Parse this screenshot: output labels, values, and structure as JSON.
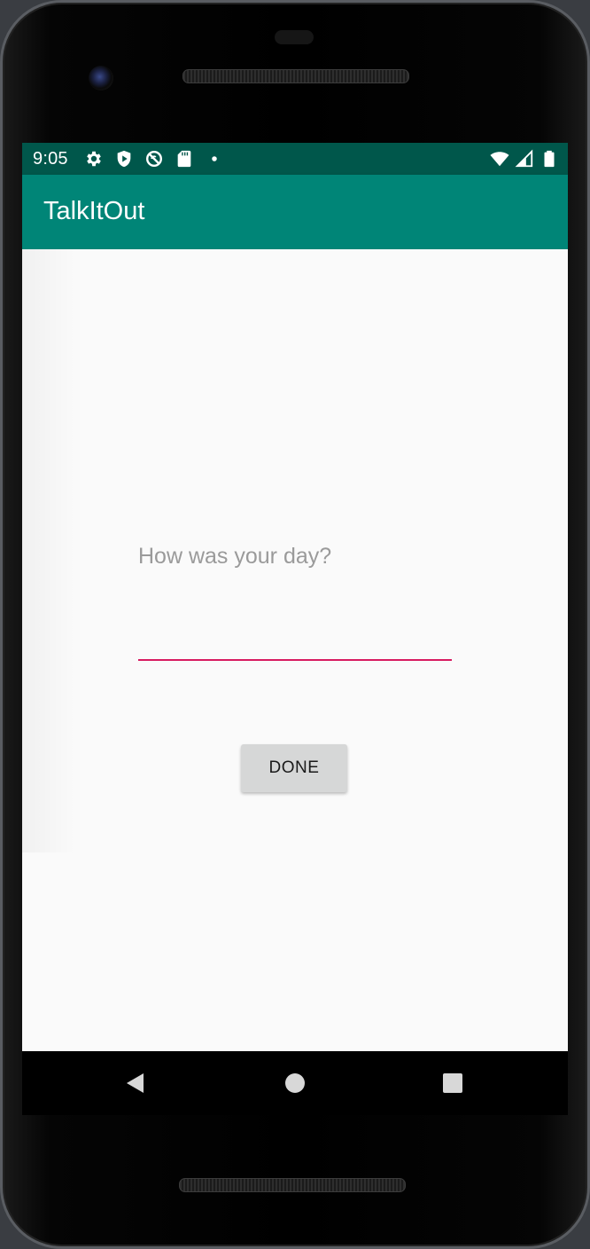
{
  "status_bar": {
    "time": "9:05",
    "left_icons": [
      "settings-icon",
      "shield-icon",
      "no-sync-icon",
      "sd-card-icon",
      "notification-dot-icon"
    ],
    "right_icons": [
      "wifi-icon",
      "cell-signal-icon",
      "battery-icon"
    ]
  },
  "app_bar": {
    "title": "TalkItOut"
  },
  "main": {
    "prompt": "How was your day?",
    "input_value": "",
    "done_label": "DONE"
  },
  "nav_bar": {
    "buttons": [
      "back-icon",
      "home-icon",
      "recents-icon"
    ]
  },
  "colors": {
    "status_bar": "#00574b",
    "app_bar": "#008577",
    "accent": "#d81b60",
    "background": "#fafafa",
    "button": "#d6d7d7"
  }
}
